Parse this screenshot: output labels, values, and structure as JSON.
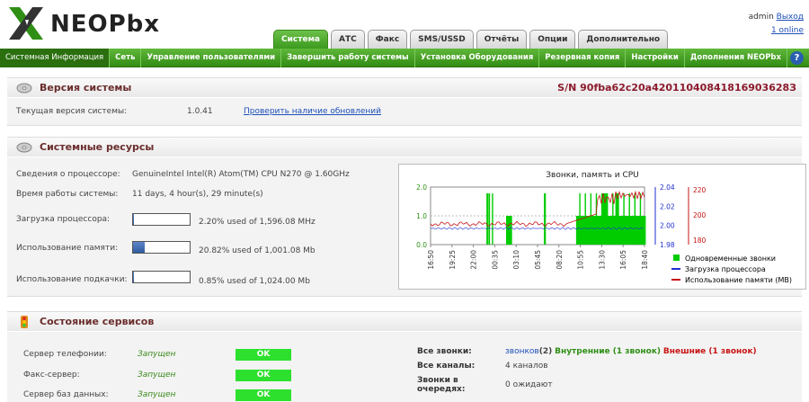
{
  "header": {
    "brand": "NEOPbx",
    "user": "admin",
    "logout": "Выход",
    "online": "1 online"
  },
  "tabs": [
    "Система",
    "АТС",
    "Факс",
    "SMS/USSD",
    "Отчёты",
    "Опции",
    "Дополнительно"
  ],
  "menu": [
    "Системная Информация",
    "Сеть",
    "Управление пользователями",
    "Завершить работу системы",
    "Установка Оборудования",
    "Резервная копия",
    "Настройки",
    "Дополнения NEOPbx"
  ],
  "version": {
    "title": "Версия системы",
    "serial": "S/N 90fba62c20a42011040841816903628З",
    "label": "Текущая версия системы:",
    "value": "1.0.41",
    "check_link": "Проверить наличие обновлений"
  },
  "resources": {
    "title": "Системные ресурсы",
    "cpu_label": "Сведения о процессоре:",
    "cpu_value": "GenuineIntel Intel(R) Atom(TM) CPU N270 @ 1.60GHz",
    "uptime_label": "Время работы системы:",
    "uptime_value": "11 days, 4 hour(s), 29 minute(s)",
    "cpu_load_label": "Загрузка процессора:",
    "cpu_load_value": "2.20% used of 1,596.08 MHz",
    "cpu_load_pct": 2.2,
    "mem_label": "Использование памяти:",
    "mem_value": "20.82% used of 1,001.08 Mb",
    "mem_pct": 20.82,
    "swap_label": "Использование подкачки:",
    "swap_value": "0.85% used of 1,024.00 Mb",
    "swap_pct": 0.85
  },
  "chart_data": {
    "type": "line",
    "title": "Звонки, память и CPU",
    "x_ticks": [
      "16:50",
      "19:25",
      "22:00",
      "00:35",
      "03:10",
      "05:45",
      "08:20",
      "10:55",
      "13:30",
      "16:05",
      "18:40"
    ],
    "y_left_ticks": [
      "0.0",
      "1.0",
      "2.0"
    ],
    "y_mid_ticks": [
      "1.98",
      "2.00",
      "2.02",
      "2.04"
    ],
    "y_right_ticks": [
      "180",
      "200",
      "220"
    ],
    "legend": [
      "Одновременные звонки",
      "Загрузка процессора",
      "Использование памяти (MB)"
    ],
    "colors": {
      "calls": "#00cc00",
      "cpu": "#1f2fd0",
      "mem": "#c81414"
    }
  },
  "services": {
    "title": "Состояние сервисов",
    "items": [
      {
        "name": "Сервер телефонии:",
        "status": "Запущен",
        "badge": "OK"
      },
      {
        "name": "Факс-сервер:",
        "status": "Запущен",
        "badge": "OK"
      },
      {
        "name": "Сервер баз данных:",
        "status": "Запущен",
        "badge": "OK"
      }
    ],
    "all_calls_label": "Все звонки:",
    "all_calls_link": "звонков",
    "all_calls_count": "(2)",
    "internal": "Внутренние (1 звонок)",
    "external": "Внешние (1 звонок)",
    "channels_label": "Все каналы:",
    "channels_value": "4 каналов",
    "queue_label_1": "Звонки в",
    "queue_label_2": "очередях:",
    "queue_value": "0 ожидают"
  }
}
